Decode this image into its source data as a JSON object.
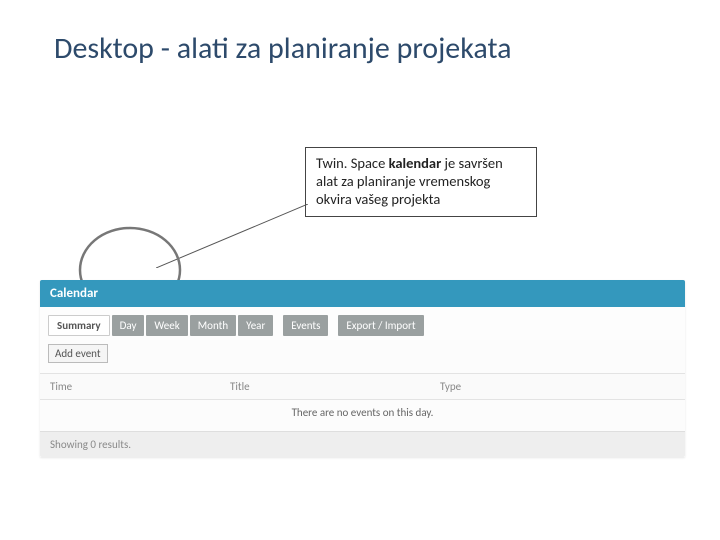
{
  "title": {
    "prefix": "Desktop - alati za  ",
    "accent": "planiranje projekata"
  },
  "callout": {
    "prefix": "Twin. Space ",
    "bold": "kalendar ",
    "rest": "je savršen alat za planiranje vremenskog okvira vašeg projekta"
  },
  "calendar": {
    "header": "Calendar",
    "tabs": [
      "Summary",
      "Day",
      "Week",
      "Month",
      "Year",
      "Events",
      "Export / Import"
    ],
    "active_tab": 0,
    "add_event": "Add event",
    "columns": {
      "time": "Time",
      "title": "Title",
      "type": "Type"
    },
    "empty": "There are no events on this day.",
    "footer": "Showing 0 results."
  }
}
